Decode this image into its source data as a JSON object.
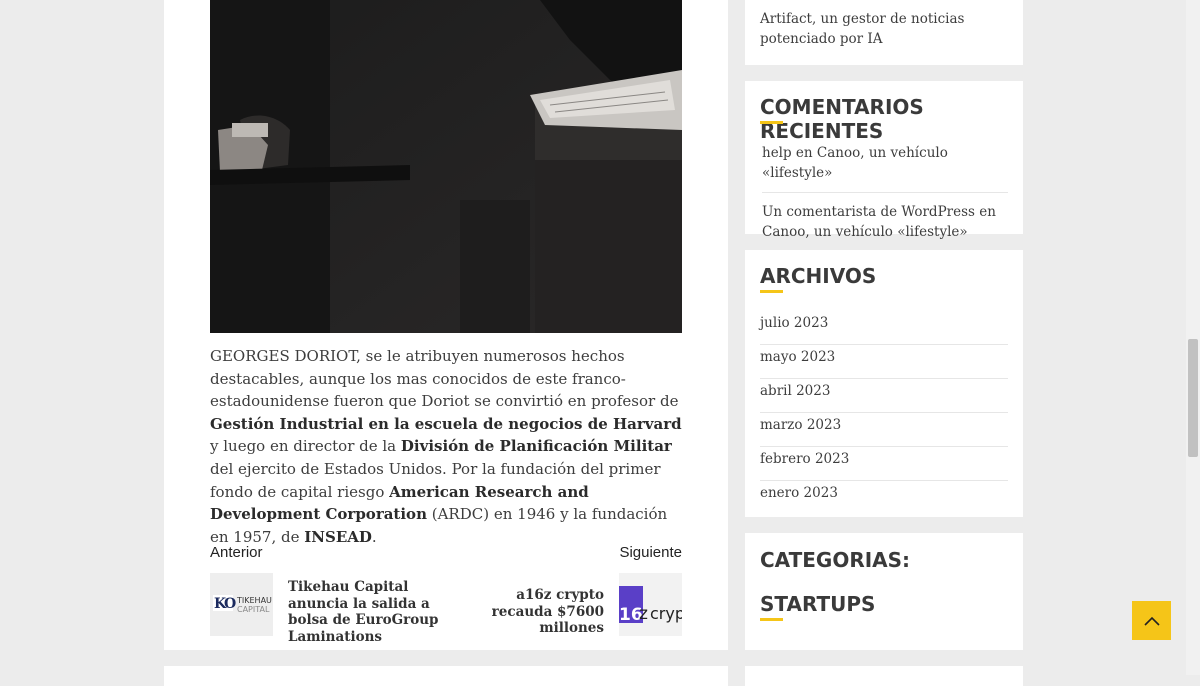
{
  "article": {
    "paragraph": [
      {
        "text": "GEORGES DORIOT, se le atribuyen numerosos hechos destacables, aunque los mas conocidos de este franco-estadounidense fueron que Doriot se convirtió en profesor de ",
        "bold": false
      },
      {
        "text": "Gestión Industrial en la escuela de negocios de Harvard",
        "bold": true
      },
      {
        "text": "  y luego en director de la ",
        "bold": false
      },
      {
        "text": "División de Planificación Militar",
        "bold": true
      },
      {
        "text": " del ejercito de Estados Unidos. Por la fundación del primer fondo de capital riesgo ",
        "bold": false
      },
      {
        "text": "American Research and Development Corporation",
        "bold": true
      },
      {
        "text": " (ARDC) en 1946 y la fundación en 1957, de ",
        "bold": false
      },
      {
        "text": "INSEAD",
        "bold": true
      },
      {
        "text": ".",
        "bold": false
      }
    ]
  },
  "post_nav": {
    "prev_label": "Anterior",
    "next_label": "Siguiente",
    "prev_title": "Tikehau Capital anuncia la salida a bolsa de EuroGroup Laminations",
    "next_title": "a16z crypto recauda $7600 millones",
    "prev_thumb_text": "TIKEHAU CAPITAL",
    "next_thumb_text": "a16z crypto"
  },
  "sidebar": {
    "top_item": "Artifact, un gestor de noticias potenciado por IA",
    "recent_comments": {
      "title": "COMENTARIOS RECIENTES",
      "items": [
        "help en Canoo, un vehículo «lifestyle»",
        "Un comentarista de WordPress en Canoo, un vehículo «lifestyle»"
      ]
    },
    "archives": {
      "title": "ARCHIVOS",
      "items": [
        "julio 2023",
        "mayo 2023",
        "abril 2023",
        "marzo 2023",
        "febrero 2023",
        "enero 2023"
      ]
    },
    "categories": {
      "title": "CATEGORIAS:",
      "subtitle": "STARTUPS"
    }
  },
  "colors": {
    "accent": "#f5c518",
    "background": "#ececec",
    "card": "#ffffff"
  },
  "icons": {
    "scroll_top": "chevron-up-icon"
  }
}
